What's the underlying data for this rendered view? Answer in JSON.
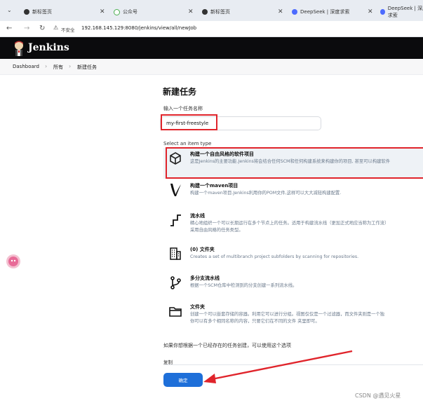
{
  "browser": {
    "tabs": [
      {
        "label": "新标签页",
        "icon": "chrome-icon",
        "color": "#333333"
      },
      {
        "label": "公众号",
        "icon": "cloud-icon",
        "color": "#4caf50"
      },
      {
        "label": "新标签页",
        "icon": "chrome-icon",
        "color": "#333333"
      },
      {
        "label": "DeepSeek | 深度求索",
        "icon": "deepseek-icon",
        "color": "#4d6bfe"
      },
      {
        "label": "DeepSeek | 深度求索",
        "icon": "deepseek-icon",
        "color": "#4d6bfe"
      }
    ],
    "security_label": "不安全",
    "url": "192.168.145.129:8080/jenkins/view/all/newJob"
  },
  "header": {
    "logo_text": "Jenkins"
  },
  "breadcrumb": [
    "Dashboard",
    "所有",
    "新建任务"
  ],
  "page": {
    "title": "新建任务",
    "name_label": "输入一个任务名称",
    "name_value": "my-first-freestyle",
    "type_label": "Select an item type",
    "items": [
      {
        "title": "构建一个自由风格的软件项目",
        "desc": [
          "这是Jenkins的主要功能.Jenkins将会结合任何SCM和任何构建系统来构建你的项目, 甚至可以构建软件"
        ],
        "icon": "package-icon"
      },
      {
        "title": "构建一个maven项目",
        "desc": [
          "构建一个maven项目.Jenkins利用你的POM文件,这样可以大大减轻构建配置."
        ],
        "icon": "maven-feather-icon"
      },
      {
        "title": "流水线",
        "desc": [
          "精心地组织一个可以长期运行在多个节点上的任务。适用于构建流水线（更加正式地应当称为工作流）",
          "采用自由风格的任务类型。"
        ],
        "icon": "pipeline-icon"
      },
      {
        "title": "(0) 文件夹",
        "desc": [
          "Creates a set of multibranch project subfolders by scanning for repositories."
        ],
        "icon": "organization-folder-icon"
      },
      {
        "title": "多分支流水线",
        "desc": [
          "根据一个SCM仓库中检测到的分支创建一系列流水线。"
        ],
        "icon": "branch-icon"
      },
      {
        "title": "文件夹",
        "desc": [
          "创建一个可以嵌套存储的容器。利用它可以进行分组。视图仅仅是一个过滤器，而文件夹则是一个独",
          "你可以有多个相同名称的内容，只要它们在不同的文件 夹里即可。"
        ],
        "icon": "folder-icon"
      }
    ],
    "copy_hint": "如果你想根据一个已经存在的任务创建，可以使用这个选项",
    "copy_label": "复制",
    "ok_label": "确定"
  },
  "annotation": {
    "highlight_color": "#e0242b"
  },
  "watermark": "CSDN @遇见火星"
}
